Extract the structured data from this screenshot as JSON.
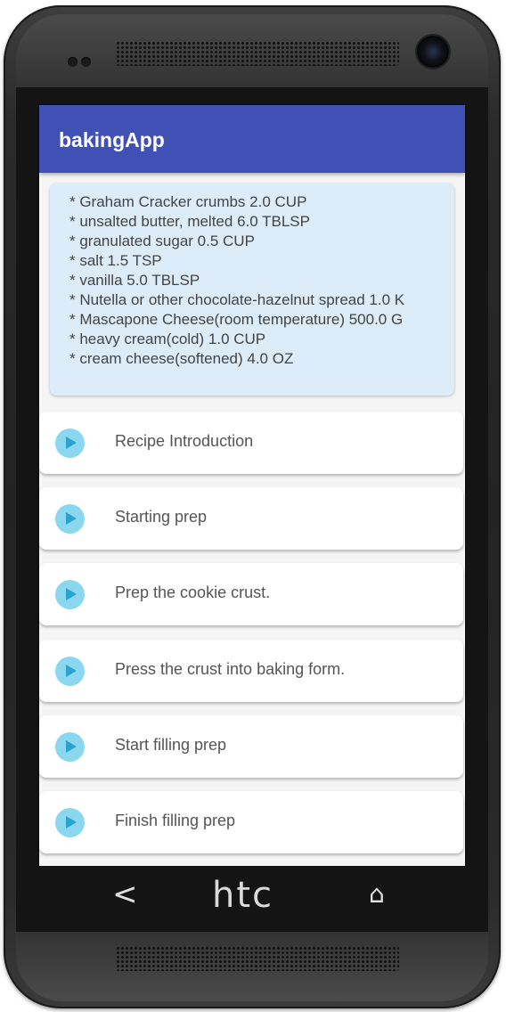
{
  "app": {
    "title": "bakingApp"
  },
  "ingredients": [
    "*  Graham Cracker crumbs  2.0  CUP",
    "*  unsalted butter, melted  6.0  TBLSP",
    "*  granulated sugar  0.5  CUP",
    "*  salt  1.5  TSP",
    "*  vanilla  5.0  TBLSP",
    "*  Nutella or other chocolate-hazelnut spread  1.0  K",
    "*  Mascapone Cheese(room temperature)  500.0  G",
    "*  heavy cream(cold)  1.0  CUP",
    "*  cream cheese(softened)  4.0  OZ"
  ],
  "steps": [
    {
      "label": "Recipe Introduction",
      "icon": "play-icon"
    },
    {
      "label": "Starting prep",
      "icon": "play-icon"
    },
    {
      "label": "Prep the cookie crust.",
      "icon": "play-icon"
    },
    {
      "label": "Press the crust into baking form.",
      "icon": "play-icon"
    },
    {
      "label": "Start filling prep",
      "icon": "play-icon"
    },
    {
      "label": "Finish filling prep",
      "icon": "play-icon"
    }
  ],
  "device": {
    "brand": "htc",
    "back_icon": "back-icon",
    "home_icon": "home-icon",
    "back_glyph": "<",
    "home_glyph": "⌂"
  },
  "colors": {
    "appbar": "#3f51b5",
    "ingredients_bg": "#dcecf9",
    "play_icon": "#8ad7ef"
  }
}
